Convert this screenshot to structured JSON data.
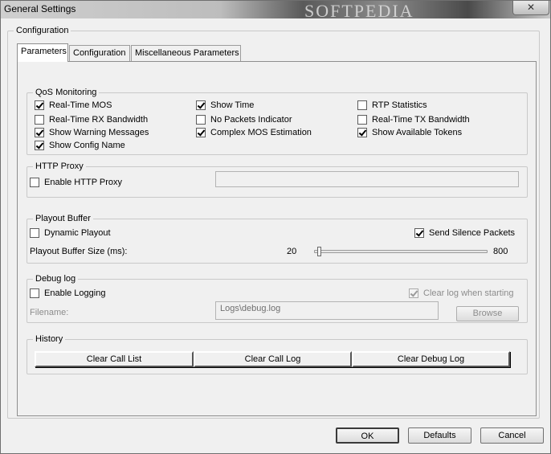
{
  "window": {
    "title": "General Settings",
    "close_glyph": "✕",
    "titlebar_watermark": "SOFTPEDIA"
  },
  "outer_group": {
    "label": "Configuration"
  },
  "tabs": [
    {
      "label": "Parameters",
      "active": true
    },
    {
      "label": "Configuration",
      "active": false
    },
    {
      "label": "Miscellaneous Parameters",
      "active": false
    }
  ],
  "qos": {
    "label": "QoS Monitoring",
    "items": [
      {
        "label": "Real-Time MOS",
        "checked": true
      },
      {
        "label": "Real-Time RX Bandwidth",
        "checked": false
      },
      {
        "label": "Show Warning Messages",
        "checked": true
      },
      {
        "label": "Show Config Name",
        "checked": true
      },
      {
        "label": "Show Time",
        "checked": true
      },
      {
        "label": "No Packets Indicator",
        "checked": false
      },
      {
        "label": "Complex MOS Estimation",
        "checked": true
      },
      {
        "label": "RTP Statistics",
        "checked": false
      },
      {
        "label": "Real-Time TX Bandwidth",
        "checked": false
      },
      {
        "label": "Show Available Tokens",
        "checked": true
      }
    ]
  },
  "http_proxy": {
    "label": "HTTP Proxy",
    "enable_label": "Enable HTTP Proxy",
    "enabled": false,
    "address_value": ""
  },
  "playout": {
    "label": "Playout Buffer",
    "dynamic_label": "Dynamic Playout",
    "dynamic_checked": false,
    "silence_label": "Send Silence Packets",
    "silence_checked": true,
    "size_label": "Playout Buffer Size (ms):",
    "min_label": "20",
    "max_label": "800",
    "min": 20,
    "max": 800,
    "value": 40
  },
  "debug": {
    "label": "Debug log",
    "enable_label": "Enable Logging",
    "enable_checked": false,
    "clear_label": "Clear log when starting",
    "clear_checked": true,
    "filename_label": "Filename:",
    "filename_value": "Logs\\debug.log",
    "browse_label": "Browse"
  },
  "history": {
    "label": "History",
    "clear_call_list": "Clear Call List",
    "clear_call_log": "Clear Call Log",
    "clear_debug_log": "Clear Debug Log"
  },
  "footer": {
    "ok": "OK",
    "defaults": "Defaults",
    "cancel": "Cancel"
  }
}
